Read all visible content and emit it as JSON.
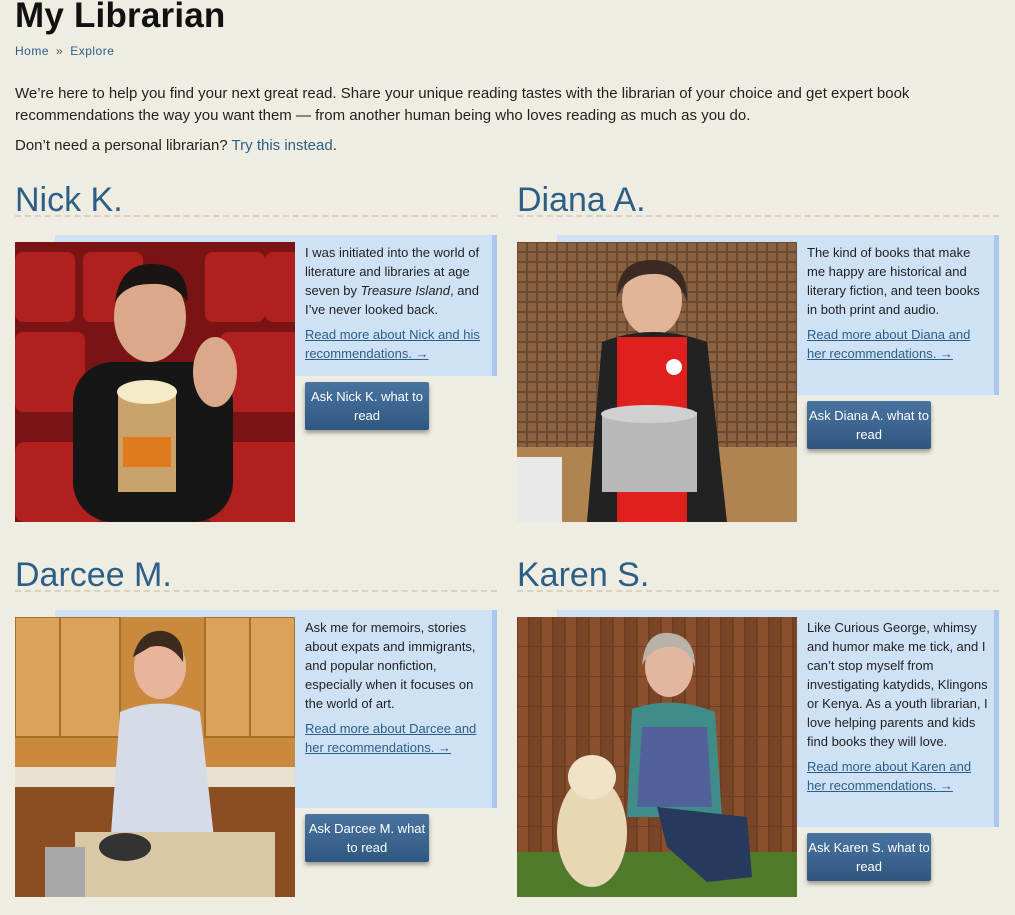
{
  "page": {
    "title": "My Librarian",
    "breadcrumb": {
      "home": "Home",
      "separator": "»",
      "explore": "Explore"
    },
    "intro": "We’re here to help you find your next great read. Share your unique reading tastes with the librarian of your choice and get expert book recommendations the way you want them — from another human being who loves reading as much as you do.",
    "alt_prompt": "Don’t need a personal librarian?",
    "alt_link": "Try this instead",
    "alt_suffix": "."
  },
  "librarians": [
    {
      "name": "Nick K.",
      "bio_before": "I was initiated into the world of literature and libraries at age seven by ",
      "bio_italic": "Treasure Island",
      "bio_after": ", and I’ve never looked back.",
      "read_more": "Read more about Nick and his recommendations. →",
      "ask": "Ask Nick K. what to read"
    },
    {
      "name": "Diana A.",
      "bio_before": "The kind of books that make me happy are historical and literary fiction, and teen books in both print and audio.",
      "bio_italic": "",
      "bio_after": "",
      "read_more": "Read more about Diana and her recommendations. →",
      "ask": "Ask Diana A. what to read"
    },
    {
      "name": "Darcee M.",
      "bio_before": "Ask me for memoirs, stories about expats and immigrants, and popular nonfiction, especially when it focuses on the world of art.",
      "bio_italic": "",
      "bio_after": "",
      "read_more": "Read more about Darcee and her recommendations. →",
      "ask": "Ask Darcee M. what to read"
    },
    {
      "name": "Karen S.",
      "bio_before": "Like Curious George, whimsy and humor make me tick, and I can’t stop myself from investigating katydids, Klingons or Kenya. As a youth librarian, I love helping parents and kids find books they will love.",
      "bio_italic": "",
      "bio_after": "",
      "read_more": "Read more about Karen and her recommendations. →",
      "ask": "Ask Karen S. what to read"
    }
  ]
}
